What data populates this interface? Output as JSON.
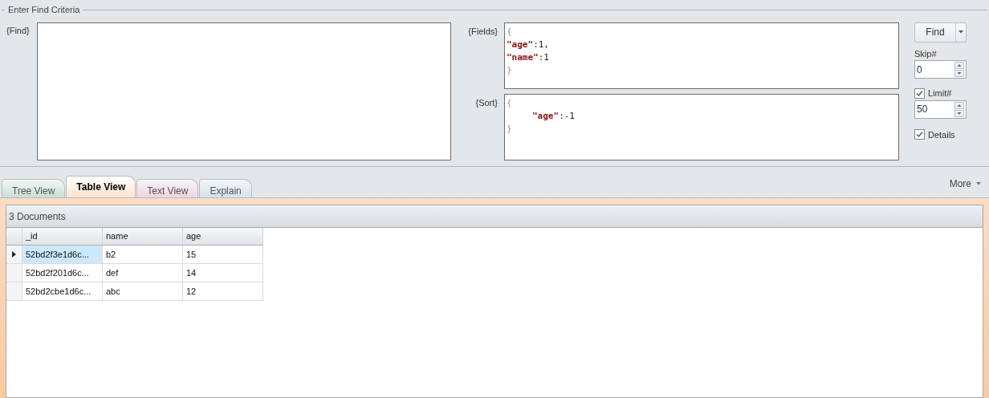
{
  "criteria": {
    "title": "Enter Find Criteria",
    "find": {
      "label": "{Find}"
    },
    "fields": {
      "label": "{Fields}",
      "lines": [
        {
          "indent": false,
          "tokens": [
            {
              "kind": "brace",
              "text": "{"
            }
          ]
        },
        {
          "indent": false,
          "tokens": [
            {
              "kind": "key",
              "text": "\"age\""
            },
            {
              "kind": "value",
              "text": ":1,"
            }
          ]
        },
        {
          "indent": false,
          "tokens": [
            {
              "kind": "key",
              "text": "\"name\""
            },
            {
              "kind": "value",
              "text": ":1"
            }
          ]
        },
        {
          "indent": false,
          "tokens": [
            {
              "kind": "brace",
              "text": "}"
            }
          ]
        }
      ]
    },
    "sort": {
      "label": "{Sort}",
      "lines": [
        {
          "indent": false,
          "tokens": [
            {
              "kind": "brace",
              "text": "{"
            }
          ]
        },
        {
          "indent": true,
          "tokens": [
            {
              "kind": "key",
              "text": "\"age\""
            },
            {
              "kind": "value",
              "text": ":-1"
            }
          ]
        },
        {
          "indent": false,
          "tokens": [
            {
              "kind": "brace",
              "text": "}"
            }
          ]
        }
      ]
    },
    "find_button": "Find",
    "skip": {
      "label": "Skip#",
      "value": "0"
    },
    "limit": {
      "label": "Limit#",
      "checked": true,
      "value": "50"
    },
    "details": {
      "label": "Details",
      "checked": true
    }
  },
  "tabs": [
    {
      "label": "Tree View",
      "selected": false,
      "color": "#c9dfd3"
    },
    {
      "label": "Table View",
      "selected": true,
      "color": "#fde3cc"
    },
    {
      "label": "Text View",
      "selected": false,
      "color": "#f1d3e0"
    },
    {
      "label": "Explain",
      "selected": false,
      "color": "#d3e2ee"
    }
  ],
  "more": "More",
  "results": {
    "count": "3 Documents",
    "columns": [
      "_id",
      "name",
      "age"
    ],
    "rows": [
      {
        "selected": true,
        "cells": [
          "52bd2f3e1d6c...",
          "b2",
          "15"
        ]
      },
      {
        "selected": false,
        "cells": [
          "52bd2f201d6c...",
          "def",
          "14"
        ]
      },
      {
        "selected": false,
        "cells": [
          "52bd2cbe1d6c...",
          "abc",
          "12"
        ]
      }
    ]
  }
}
